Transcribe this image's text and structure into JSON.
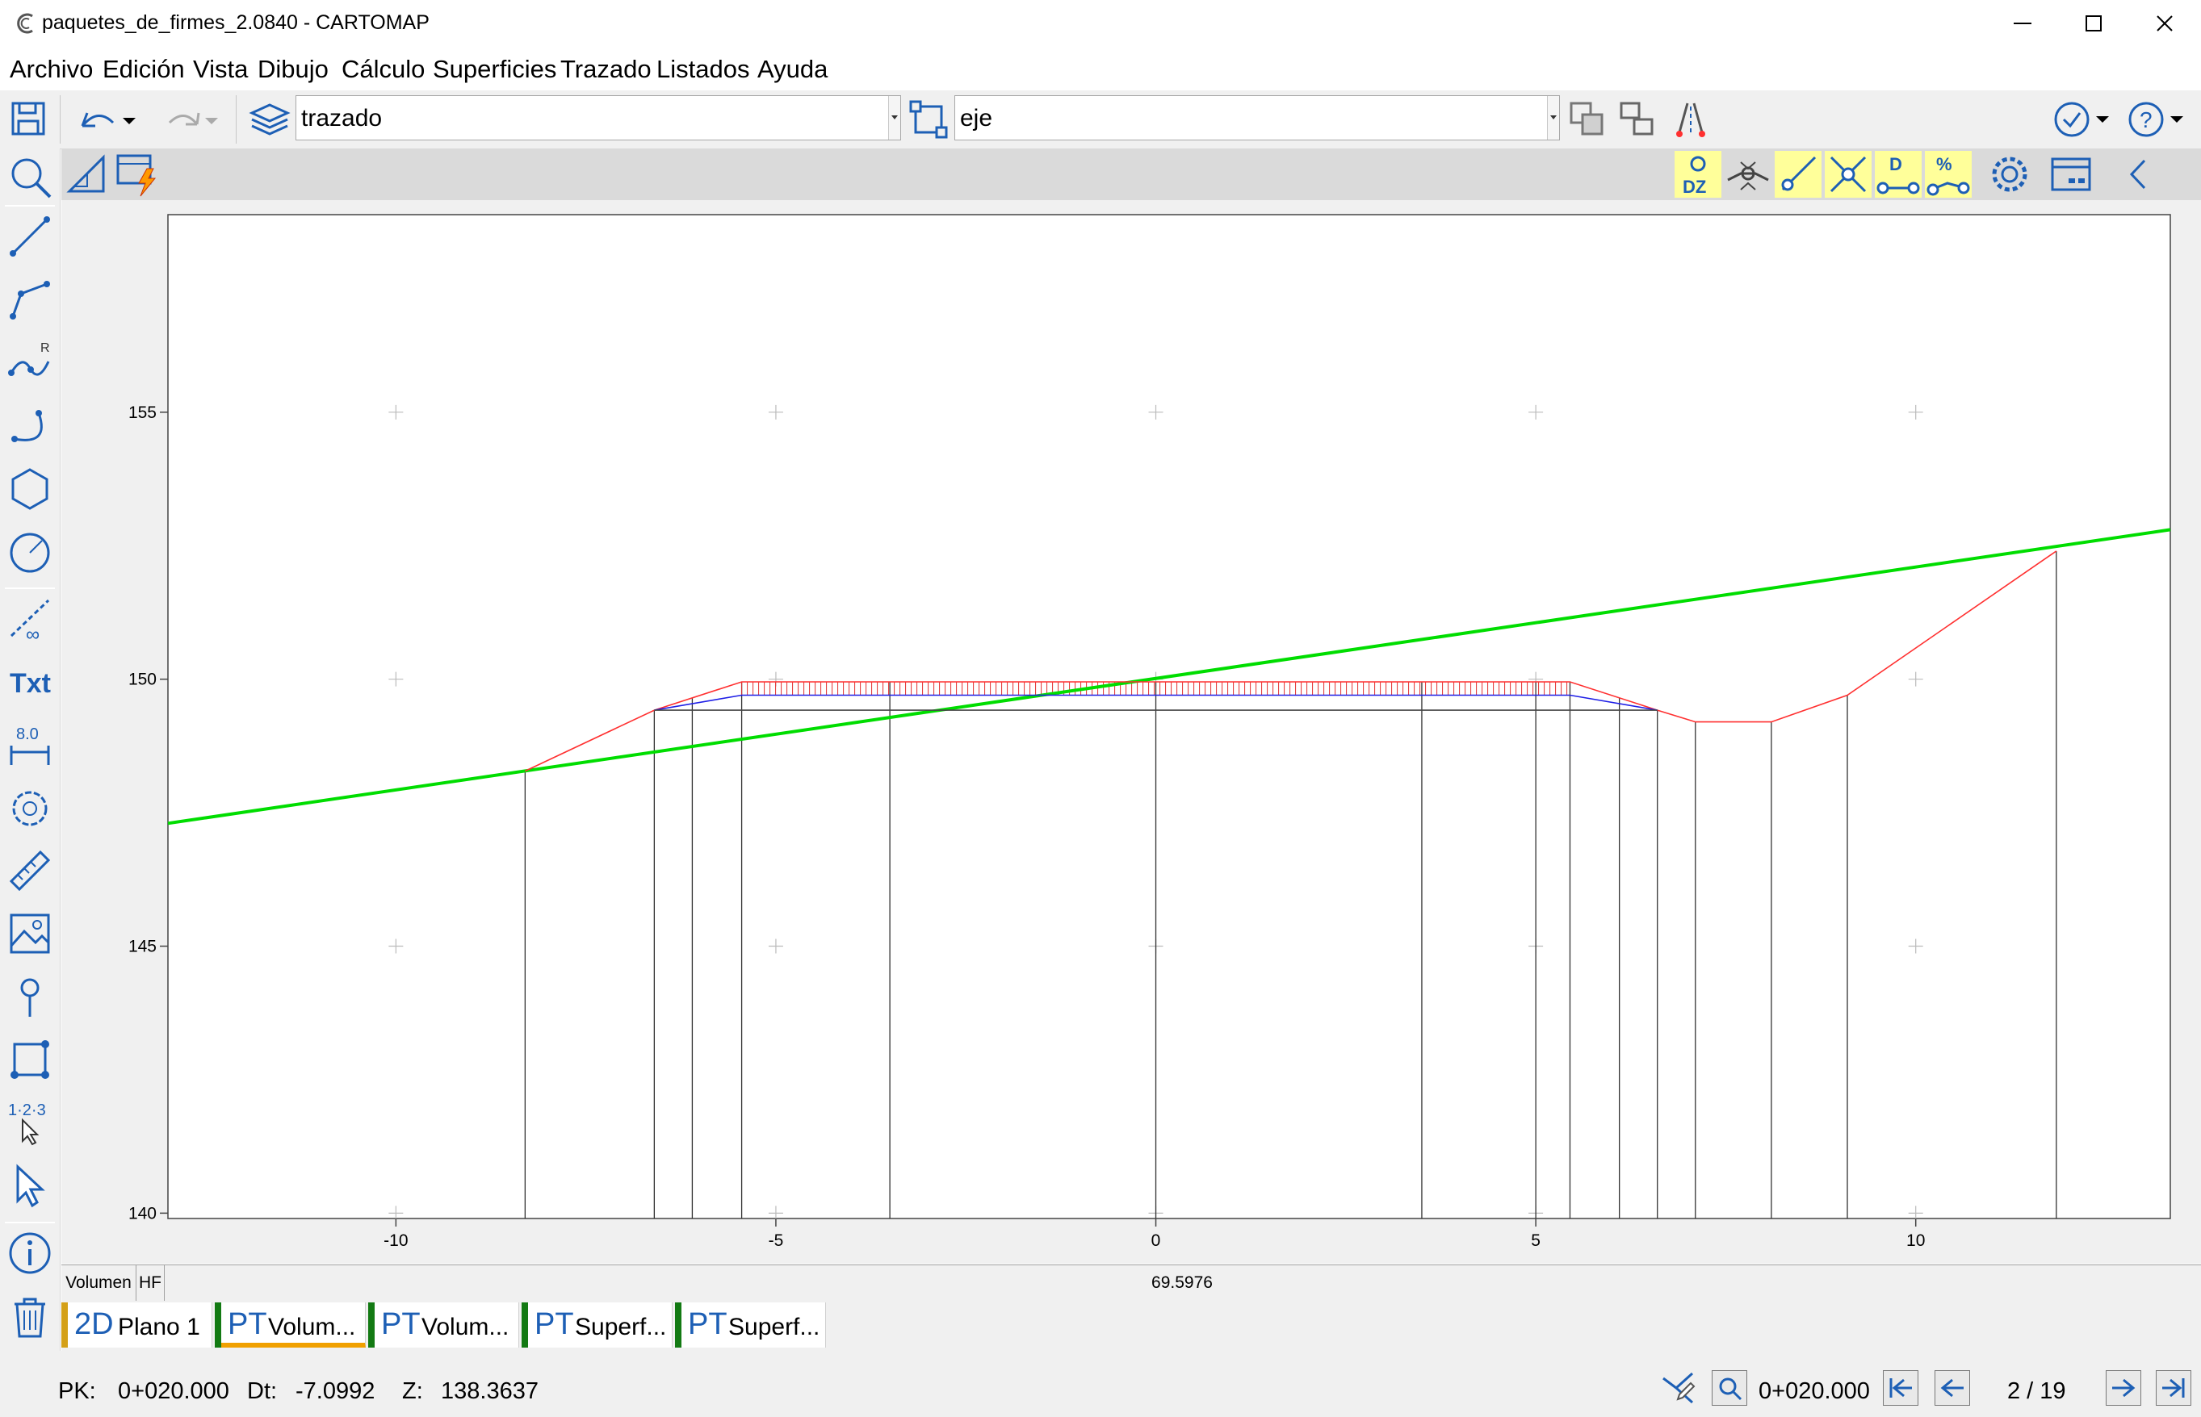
{
  "window": {
    "title": "paquetes_de_firmes_2.0840 - CARTOMAP"
  },
  "menu": [
    "Archivo",
    "Edición",
    "Vista",
    "Dibujo",
    "Cálculo",
    "Superficies",
    "Trazado",
    "Listados",
    "Ayuda"
  ],
  "toolbar": {
    "layer_value": "trazado",
    "entity_value": "eje"
  },
  "volume_bar": {
    "label": "Volumen",
    "code": "HF",
    "value": "69.5976"
  },
  "tabs": [
    {
      "type": "2D",
      "label": "Plano 1",
      "mark_color": "#d4a017",
      "active": false
    },
    {
      "type": "PT",
      "label": "Volum...",
      "mark_color": "#137a13",
      "active": true
    },
    {
      "type": "PT",
      "label": "Volum...",
      "mark_color": "#137a13",
      "active": false
    },
    {
      "type": "PT",
      "label": "Superf...",
      "mark_color": "#137a13",
      "active": false
    },
    {
      "type": "PT",
      "label": "Superf...",
      "mark_color": "#137a13",
      "active": false
    }
  ],
  "status": {
    "pk_label": "PK:",
    "pk_value": "0+020.000",
    "dt_label": "Dt:",
    "dt_value": "-7.0992",
    "z_label": "Z:",
    "z_value": "138.3637",
    "station_value": "0+020.000",
    "page": "2 / 19"
  },
  "icons": {
    "left_toolbar": [
      "zoom-icon",
      "line-icon",
      "polyline-icon",
      "spline-icon",
      "arc-icon",
      "polygon-icon",
      "circle-icon",
      "infinite-line-icon",
      "text-icon",
      "dimension-icon",
      "cloud-icon",
      "ruler-icon",
      "image-icon",
      "pin-icon",
      "region-icon",
      "numbering-icon",
      "select-icon",
      "info-icon",
      "trash-icon"
    ],
    "toolbar2_right": [
      "dz-icon",
      "snap-node-icon",
      "snap-line-icon",
      "snap-intersection-icon",
      "snap-distance-icon",
      "snap-percent-icon",
      "settings-icon",
      "panel-icon",
      "collapse-icon"
    ]
  },
  "chart_data": {
    "type": "line",
    "x_ticks": [
      "-10",
      "-5",
      "0",
      "5",
      "10"
    ],
    "y_ticks": [
      "140",
      "145",
      "150",
      "155"
    ],
    "xlim": [
      -13,
      13.35
    ],
    "ylim": [
      139.9,
      158.7
    ],
    "series": [
      {
        "role": "terrain",
        "color": "#00dd00",
        "x": [
          -13,
          13.35
        ],
        "y": [
          147.3,
          152.8
        ]
      },
      {
        "role": "subgrade",
        "color": "#ff3030",
        "x": [
          -8.3,
          -6.6,
          -5.45,
          5.45,
          6.6,
          7.1,
          8.1,
          9.1,
          11.85
        ],
        "y": [
          148.28,
          149.42,
          149.95,
          149.95,
          149.42,
          149.2,
          149.2,
          149.7,
          152.4
        ]
      },
      {
        "role": "pavement-top",
        "color": "#1e1ee6",
        "x": [
          -6.6,
          -5.45,
          5.45,
          6.6
        ],
        "y": [
          149.42,
          149.7,
          149.7,
          149.42
        ]
      },
      {
        "role": "formation",
        "color": "#444444",
        "x": [
          -6.6,
          6.6
        ],
        "y": [
          149.42,
          149.42
        ]
      }
    ],
    "section_lines_x": [
      -8.3,
      -6.6,
      -6.1,
      -5.45,
      -3.5,
      0,
      3.5,
      5.0,
      5.45,
      6.1,
      6.6,
      7.1,
      8.1,
      9.1,
      11.85
    ],
    "hatch_range_x": [
      -5.45,
      5.45
    ]
  }
}
